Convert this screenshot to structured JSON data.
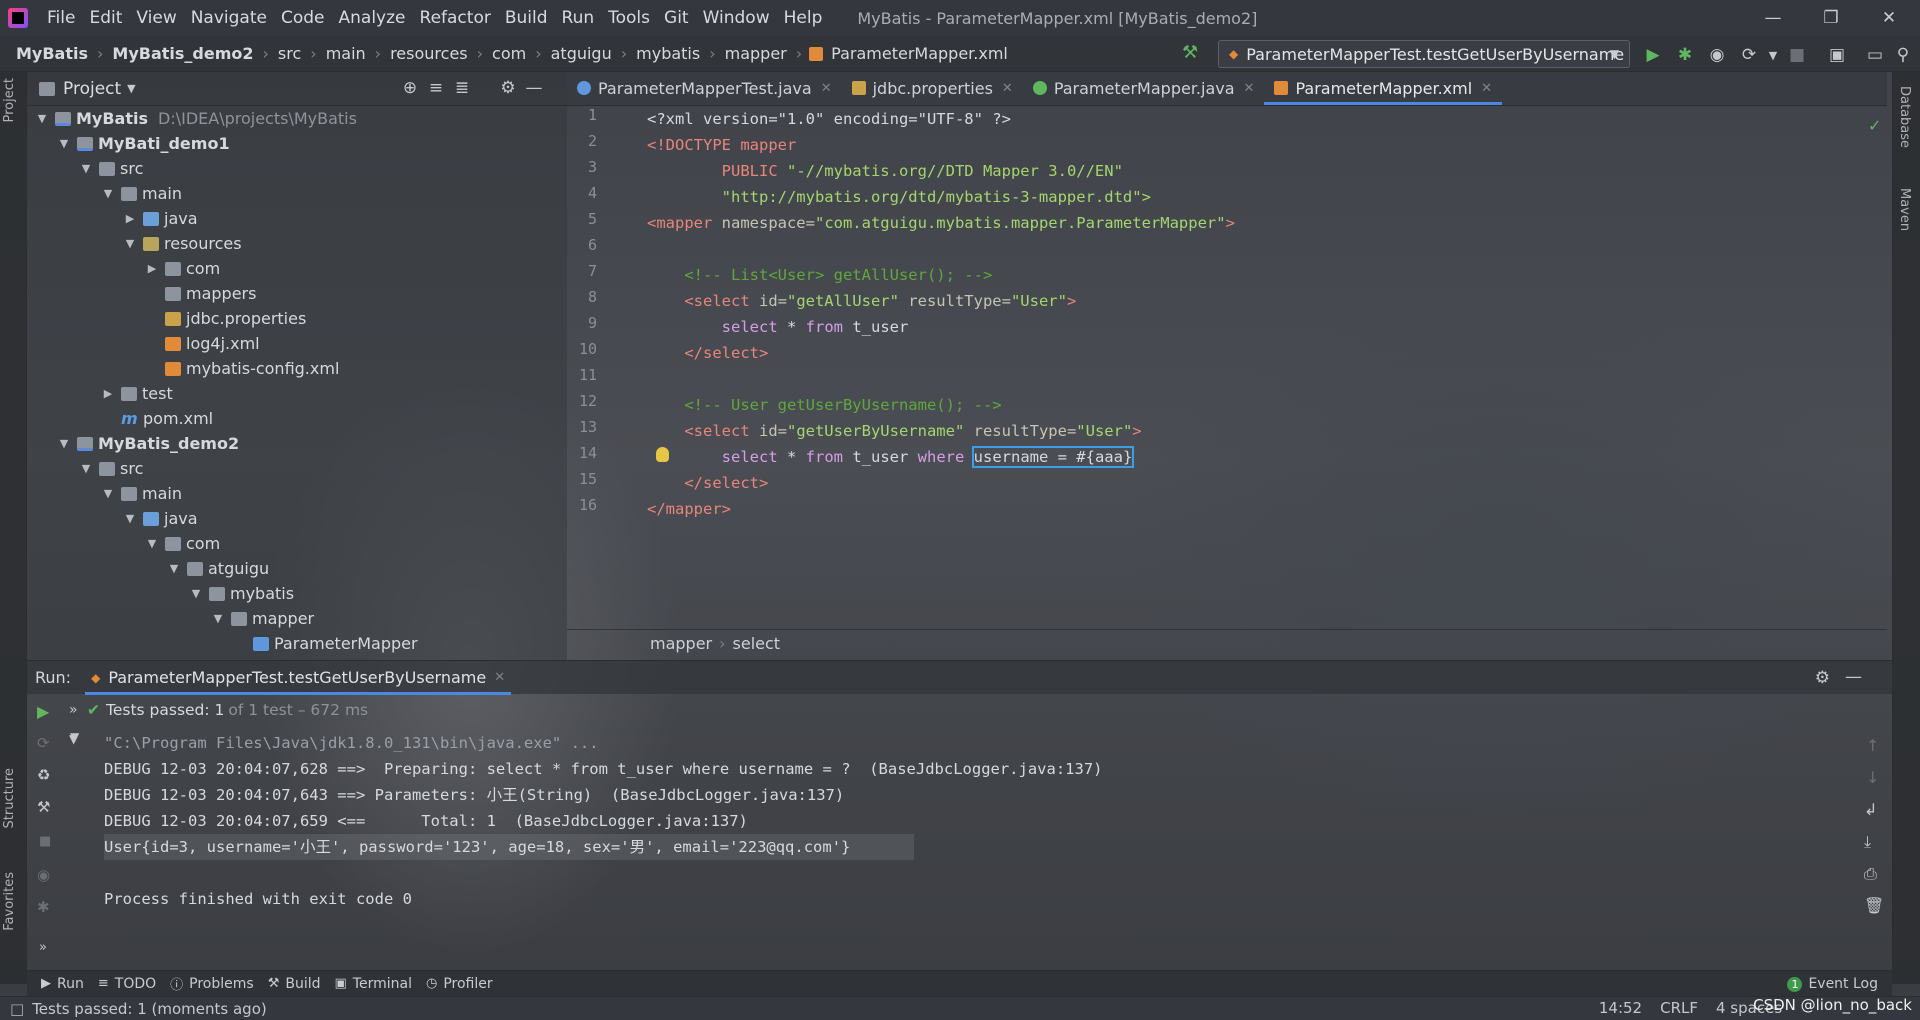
{
  "menubar": {
    "items": [
      "File",
      "Edit",
      "View",
      "Navigate",
      "Code",
      "Analyze",
      "Refactor",
      "Build",
      "Run",
      "Tools",
      "Git",
      "Window",
      "Help"
    ],
    "window_title": "MyBatis - ParameterMapper.xml [MyBatis_demo2]"
  },
  "navbar": {
    "crumbs": [
      "MyBatis",
      "MyBatis_demo2",
      "src",
      "main",
      "resources",
      "com",
      "atguigu",
      "mybatis",
      "mapper",
      "ParameterMapper.xml"
    ],
    "run_config": "ParameterMapperTest.testGetUserByUsername"
  },
  "left_strip": {
    "project": "Project",
    "structure": "Structure",
    "favorites": "Favorites"
  },
  "right_strip": {
    "database": "Database",
    "maven": "Maven"
  },
  "project": {
    "header": "Project",
    "tree": [
      {
        "label": "MyBatis",
        "extra": "D:\\IDEA\\projects\\MyBatis"
      },
      {
        "label": "MyBati_demo1"
      },
      {
        "label": "src"
      },
      {
        "label": "main"
      },
      {
        "label": "java"
      },
      {
        "label": "resources"
      },
      {
        "label": "com"
      },
      {
        "label": "mappers"
      },
      {
        "label": "jdbc.properties"
      },
      {
        "label": "log4j.xml"
      },
      {
        "label": "mybatis-config.xml"
      },
      {
        "label": "test"
      },
      {
        "label": "pom.xml"
      },
      {
        "label": "MyBatis_demo2"
      },
      {
        "label": "src"
      },
      {
        "label": "main"
      },
      {
        "label": "java"
      },
      {
        "label": "com"
      },
      {
        "label": "atguigu"
      },
      {
        "label": "mybatis"
      },
      {
        "label": "mapper"
      },
      {
        "label": "ParameterMapper"
      }
    ]
  },
  "editor": {
    "tabs": [
      "ParameterMapperTest.java",
      "jdbc.properties",
      "ParameterMapper.java",
      "ParameterMapper.xml"
    ],
    "active_tab": "ParameterMapper.xml",
    "line_numbers": [
      "1",
      "2",
      "3",
      "4",
      "5",
      "6",
      "7",
      "8",
      "9",
      "10",
      "11",
      "12",
      "13",
      "14",
      "15",
      "16"
    ],
    "lines": {
      "l1": "<?xml version=\"1.0\" encoding=\"UTF-8\" ?>",
      "l2a": "<!DOCTYPE",
      "l2b": " mapper",
      "l3a": "        PUBLIC ",
      "l3b": "\"-//mybatis.org//DTD Mapper 3.0//EN\"",
      "l4": "        \"http://mybatis.org/dtd/mybatis-3-mapper.dtd\">",
      "l5a": "<mapper ",
      "l5b": "namespace=",
      "l5c": "\"com.atguigu.mybatis.mapper.ParameterMapper\"",
      "l5d": ">",
      "l7": "    <!-- List<User> getAllUser(); -->",
      "l8a": "    <select ",
      "l8b": "id=",
      "l8c": "\"getAllUser\"",
      "l8d": " resultType=",
      "l8e": "\"User\"",
      "l8f": ">",
      "l9a": "        select ",
      "l9b": "* ",
      "l9c": "from ",
      "l9d": "t_user",
      "l10": "    </select>",
      "l12": "    <!-- User getUserByUsername(); -->",
      "l13a": "    <select ",
      "l13b": "id=",
      "l13c": "\"getUserByUsername\"",
      "l13d": " resultType=",
      "l13e": "\"User\"",
      "l13f": ">",
      "l14a": "        select ",
      "l14b": "* ",
      "l14c": "from ",
      "l14d": "t_user ",
      "l14e": "where ",
      "l14f": "username = #{aaa}",
      "l15": "    </select>",
      "l16": "</mapper>"
    },
    "breadcrumb": [
      "mapper",
      "select"
    ]
  },
  "run": {
    "label": "Run:",
    "tab": "ParameterMapperTest.testGetUserByUsername",
    "tests_passed": "Tests passed: 1",
    "tests_detail": "of 1 test – 672 ms",
    "console": [
      "\"C:\\Program Files\\Java\\jdk1.8.0_131\\bin\\java.exe\" ...",
      "DEBUG 12-03 20:04:07,628 ==>  Preparing: select * from t_user where username = ?  (BaseJdbcLogger.java:137)",
      "DEBUG 12-03 20:04:07,643 ==> Parameters: 小王(String)  (BaseJdbcLogger.java:137)",
      "DEBUG 12-03 20:04:07,659 <==      Total: 1  (BaseJdbcLogger.java:137)",
      "User{id=3, username='小王', password='123', age=18, sex='男', email='223@qq.com'}",
      "",
      "Process finished with exit code 0"
    ]
  },
  "toolwindows": [
    "Run",
    "TODO",
    "Problems",
    "Build",
    "Terminal",
    "Profiler"
  ],
  "event_log": {
    "count": "1",
    "label": "Event Log"
  },
  "status": {
    "message": "Tests passed: 1 (moments ago)",
    "position": "14:52",
    "line_sep": "CRLF",
    "indent": "4 spaces",
    "watermark": "CSDN @lion_no_back"
  },
  "colors": {
    "accent": "#4a88e3",
    "success": "#5fb85f",
    "keyword": "#e9857a",
    "string": "#a5d66e",
    "comment": "#5fa83b"
  }
}
